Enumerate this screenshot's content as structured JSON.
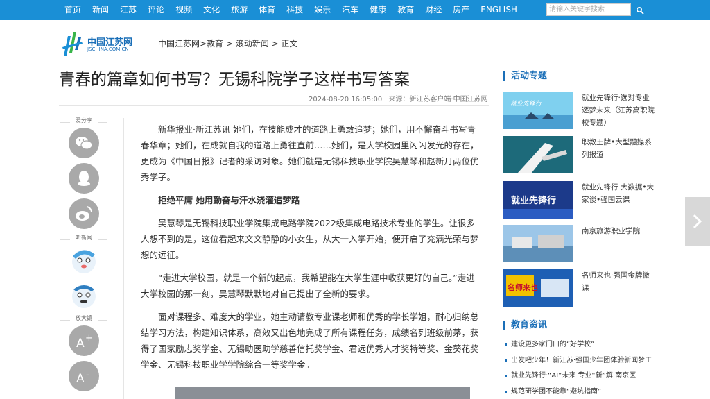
{
  "nav": {
    "items": [
      "首页",
      "新闻",
      "江苏",
      "评论",
      "视频",
      "文化",
      "旅游",
      "体育",
      "科技",
      "娱乐",
      "汽车",
      "健康",
      "教育",
      "财经",
      "房产",
      "ENGLISH"
    ],
    "search_placeholder": "请输入关键字搜索"
  },
  "logo": {
    "cn": "中国江苏网",
    "en": "JSCHINA.COM.CN"
  },
  "breadcrumb": "中国江苏网>教育 > 滚动新闻 > 正文",
  "article": {
    "title": "青春的篇章如何书写？无锡科院学子这样书写答案",
    "time": "2024-08-20 16:05:00",
    "source": "来源：新江苏客户端·中国江苏网",
    "paragraphs": [
      "新华报业·新江苏讯 她们，在技能成才的道路上勇敢追梦；她们，用不懈奋斗书写青春华章；她们，在成就自我的道路上勇往直前……她们，是大学校园里闪闪发光的存在，更成为《中国日报》记者的采访对象。她们就是无锡科技职业学院吴慧琴和赵新月两位优秀学子。",
      "拒绝平庸 她用勤奋与汗水浇灌追梦路",
      "吴慧琴是无锡科技职业学院集成电路学院2022级集成电路技术专业的学生。让很多人想不到的是，这位看起来文文静静的小女生，从大一入学开始，便开启了充满光荣与梦想的远征。",
      "“走进大学校园，就是一个新的起点，我希望能在大学生涯中收获更好的自己。”走进大学校园的那一刻，吴慧琴默默地对自己提出了全新的要求。",
      "面对课程多、难度大的学业，她主动请教专业课老师和优秀的学长学姐，耐心归纳总结学习方法，构建知识体系，高效又出色地完成了所有课程任务，成绩名列班级前茅，获得了国家励志奖学金、无锡助医助学慈善信托奖学金、君远优秀人才奖特等奖、金葵花奖学金、无锡科技职业学学院综合一等奖学金。"
    ]
  },
  "share": {
    "share_label": "爱分享",
    "listen_label": "听新闻",
    "zoom_label": "放大镜"
  },
  "sidebar": {
    "activity_title": "活动专题",
    "promos": [
      {
        "text": "就业先锋行·选对专业逐梦未来（江苏高职院校专题）",
        "img_text": "就业先锋行"
      },
      {
        "text": "职教王牌•大型融媒系列报道",
        "img_text": ""
      },
      {
        "text": "就业先锋行 大数据•大家谈•强国云课",
        "img_text": "就业先锋行"
      },
      {
        "text": "南京旅游职业学院",
        "img_text": ""
      },
      {
        "text": "名师来也·强国金牌微课",
        "img_text": "名师来也"
      }
    ],
    "edu_title": "教育资讯",
    "news": [
      "建设更多家门口的“好学校”",
      "出发吧少年！新江苏·强国少年团体验新闻梦工",
      "就业先锋行·“AI”未来 专业“新”解|南京医",
      "规范研学团不能靠“避坑指南”"
    ]
  }
}
